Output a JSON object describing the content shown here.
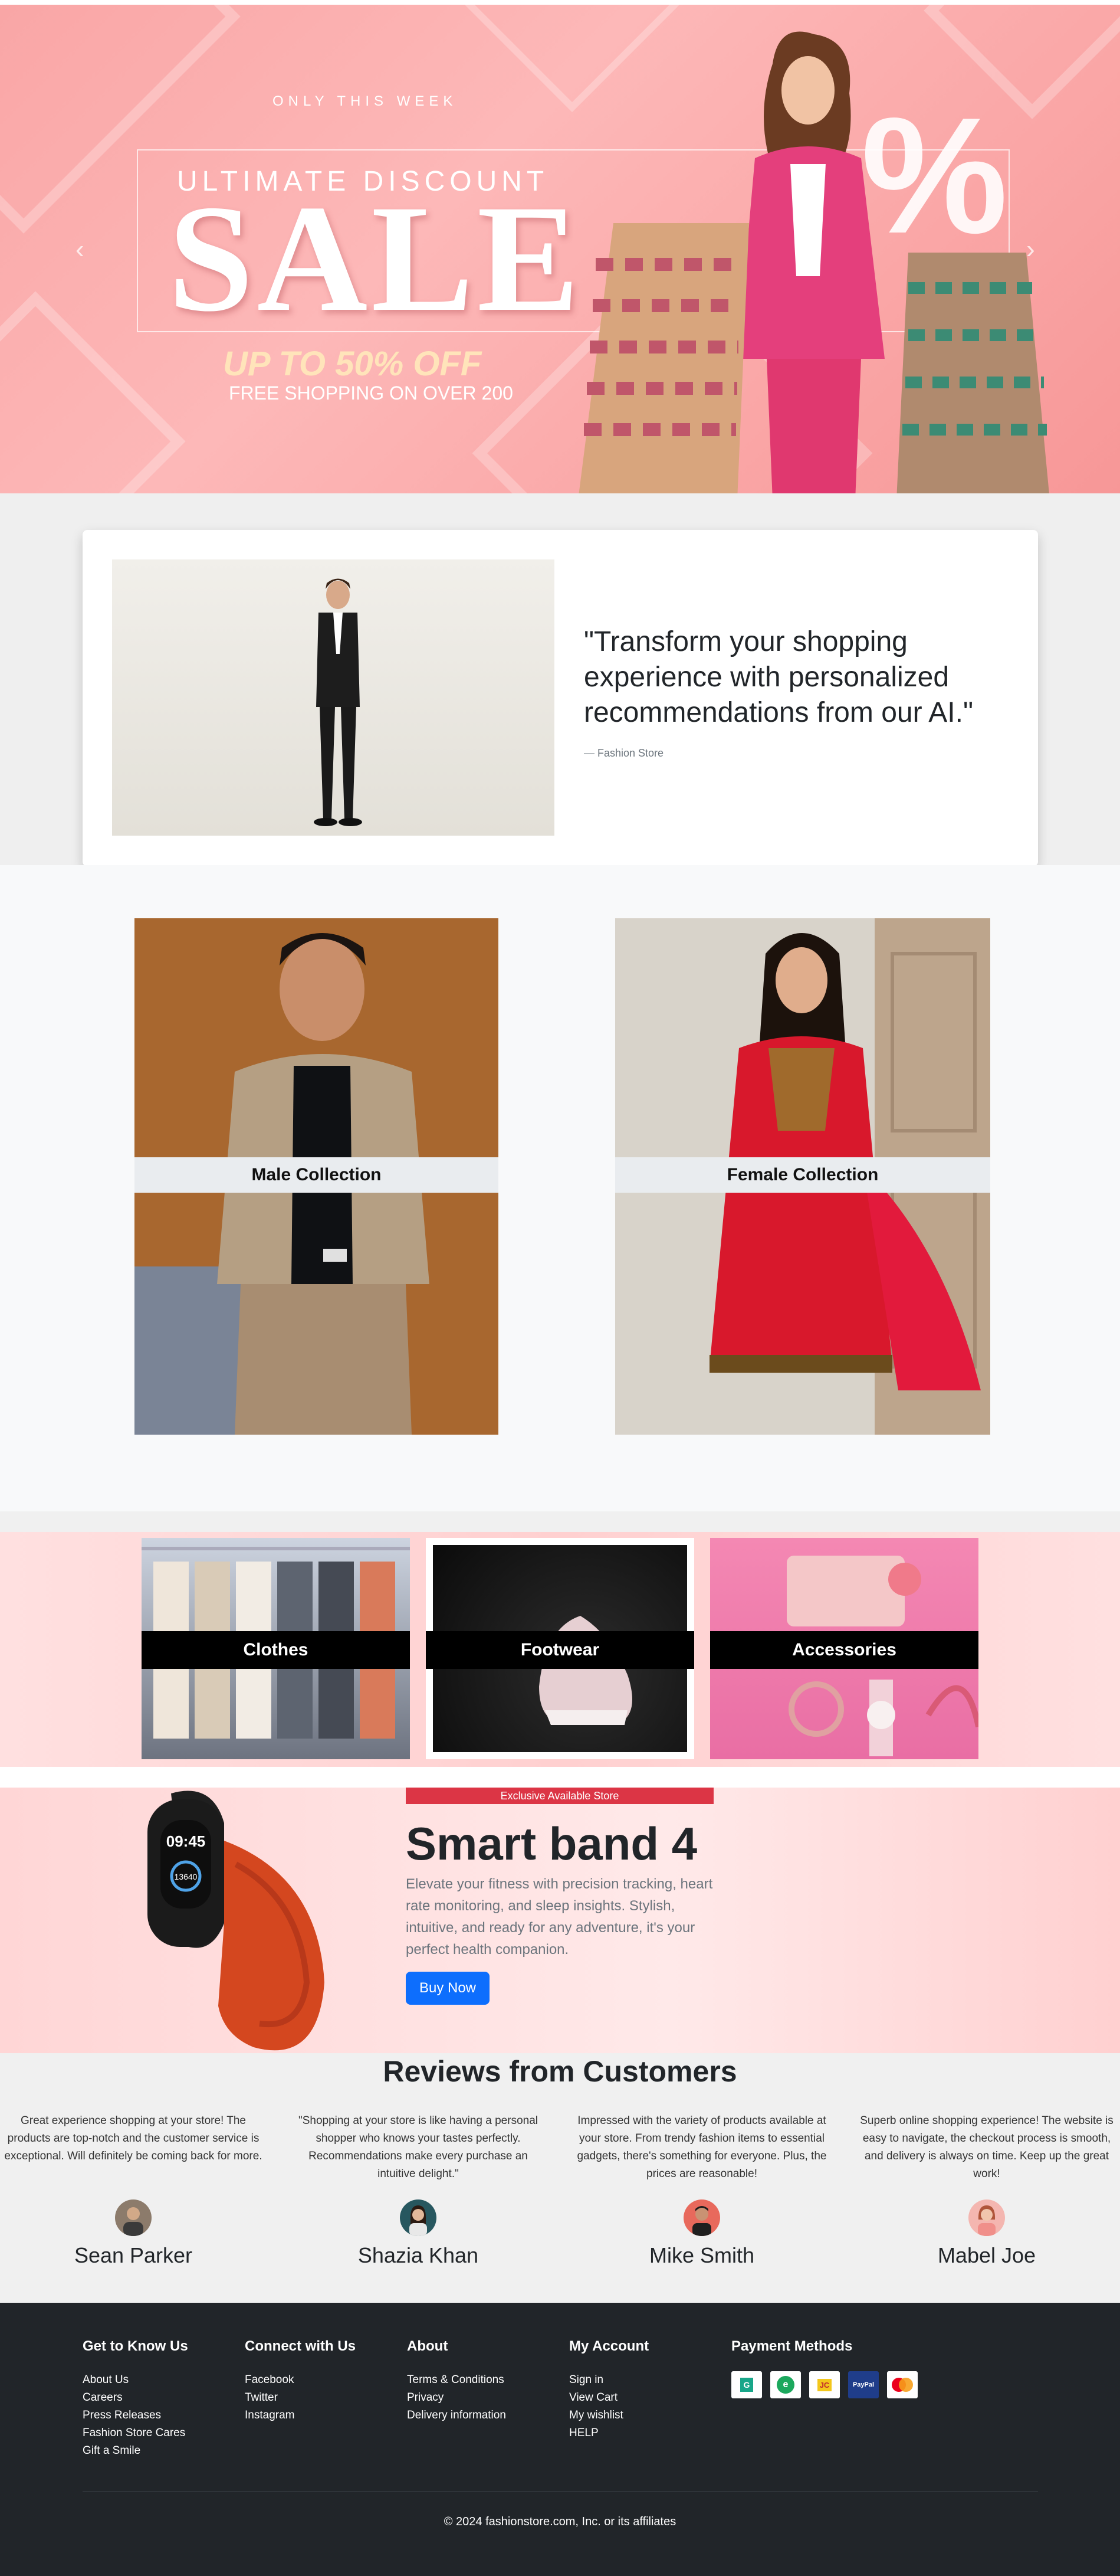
{
  "hero": {
    "eyebrow": "ONLY THIS WEEK",
    "subtitle": "ULTIMATE DISCOUNT",
    "headline": "SALE",
    "offer": "UP TO 50% OFF",
    "shipping": "FREE SHOPPING ON OVER 200",
    "percent_mark": "%",
    "prev_icon": "chevron-left-icon",
    "next_icon": "chevron-right-icon"
  },
  "testimonial": {
    "quote": "\"Transform your shopping experience with personalized recommendations from our AI.\"",
    "source": "— Fashion Store"
  },
  "collections": [
    {
      "label": "Male Collection"
    },
    {
      "label": "Female Collection"
    }
  ],
  "categories": [
    {
      "label": "Clothes"
    },
    {
      "label": "Footwear"
    },
    {
      "label": "Accessories"
    }
  ],
  "promo": {
    "badge": "Exclusive Available Store",
    "title": "Smart band 4",
    "description": "Elevate your fitness with precision tracking, heart rate monitoring, and sleep insights. Stylish, intuitive, and ready for any adventure, it's your perfect health companion.",
    "button": "Buy Now",
    "watch_time": "09:45",
    "watch_steps": "13640"
  },
  "reviews": {
    "title": "Reviews from Customers",
    "items": [
      {
        "text": "Great experience shopping at your store! The products are top-notch and the customer service is exceptional. Will definitely be coming back for more.",
        "name": "Sean Parker"
      },
      {
        "text": "\"Shopping at your store is like having a personal shopper who knows your tastes perfectly. Recommendations make every purchase an intuitive delight.\"",
        "name": "Shazia Khan"
      },
      {
        "text": "Impressed with the variety of products available at your store. From trendy fashion items to essential gadgets, there's something for everyone. Plus, the prices are reasonable!",
        "name": "Mike Smith"
      },
      {
        "text": "Superb online shopping experience! The website is easy to navigate, the checkout process is smooth, and delivery is always on time. Keep up the great work!",
        "name": "Mabel Joe"
      }
    ]
  },
  "footer": {
    "columns": [
      {
        "title": "Get to Know Us",
        "links": [
          "About Us",
          "Careers",
          "Press Releases",
          "Fashion Store Cares",
          "Gift a Smile"
        ]
      },
      {
        "title": "Connect with Us",
        "links": [
          "Facebook",
          "Twitter",
          "Instagram"
        ]
      },
      {
        "title": "About",
        "links": [
          "Terms & Conditions",
          "Privacy",
          "Delivery information"
        ]
      },
      {
        "title": "My Account",
        "links": [
          "Sign in",
          "View Cart",
          "My wishlist",
          "HELP"
        ]
      }
    ],
    "payments_title": "Payment Methods",
    "payments": [
      {
        "icon": "google-pay-icon",
        "label": "G"
      },
      {
        "icon": "easypaisa-icon",
        "label": "e"
      },
      {
        "icon": "jazzcash-icon",
        "label": "JC"
      },
      {
        "icon": "paypal-icon",
        "label": "PayPal"
      },
      {
        "icon": "mastercard-icon",
        "label": ""
      }
    ],
    "copyright": "© 2024 fashionstore.com, Inc. or its affiliates"
  },
  "colors": {
    "hero_bg": "#f9a6a6",
    "accent_red": "#dc3545",
    "primary_blue": "#0d6efd",
    "footer_bg": "#212529"
  }
}
